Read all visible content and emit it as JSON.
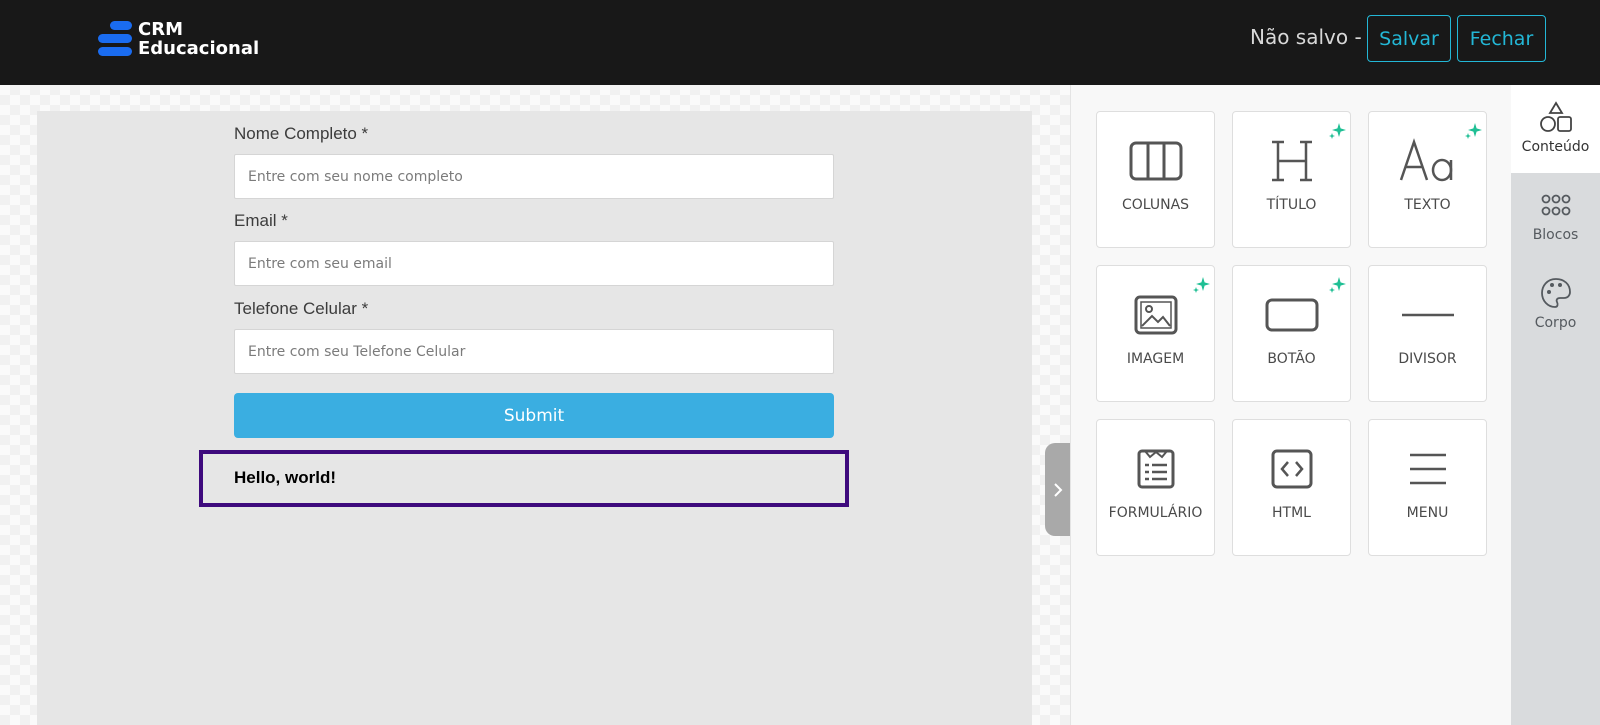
{
  "header": {
    "logo_line1": "CRM",
    "logo_line2": "Educacional",
    "status_text": "Não salvo -",
    "save_label": "Salvar",
    "close_label": "Fechar"
  },
  "form": {
    "fields": [
      {
        "label": "Nome Completo *",
        "placeholder": "Entre com seu nome completo"
      },
      {
        "label": "Email *",
        "placeholder": "Entre com seu email"
      },
      {
        "label": "Telefone Celular *",
        "placeholder": "Entre com seu Telefone Celular"
      }
    ],
    "submit_label": "Submit",
    "text_block": "Hello, world!"
  },
  "content_tools": [
    {
      "label": "COLUNAS",
      "icon": "columns-icon",
      "ai": false
    },
    {
      "label": "TÍTULO",
      "icon": "heading-icon",
      "ai": true
    },
    {
      "label": "TEXTO",
      "icon": "text-icon",
      "ai": true
    },
    {
      "label": "IMAGEM",
      "icon": "image-icon",
      "ai": true
    },
    {
      "label": "BOTÃO",
      "icon": "button-icon",
      "ai": true
    },
    {
      "label": "DIVISOR",
      "icon": "divider-icon",
      "ai": false
    },
    {
      "label": "FORMULÁRIO",
      "icon": "form-icon",
      "ai": false
    },
    {
      "label": "HTML",
      "icon": "code-icon",
      "ai": false
    },
    {
      "label": "MENU",
      "icon": "menu-icon",
      "ai": false
    }
  ],
  "side_tabs": [
    {
      "label": "Conteúdo",
      "icon": "shapes-icon",
      "active": true
    },
    {
      "label": "Blocos",
      "icon": "grid-icon",
      "active": false
    },
    {
      "label": "Corpo",
      "icon": "palette-icon",
      "active": false
    }
  ],
  "colors": {
    "topbar": "#181818",
    "accent": "#23b7d6",
    "submit": "#3aaee1",
    "selection": "#3e0a7d",
    "ai_sparkle": "#1fbf94"
  }
}
